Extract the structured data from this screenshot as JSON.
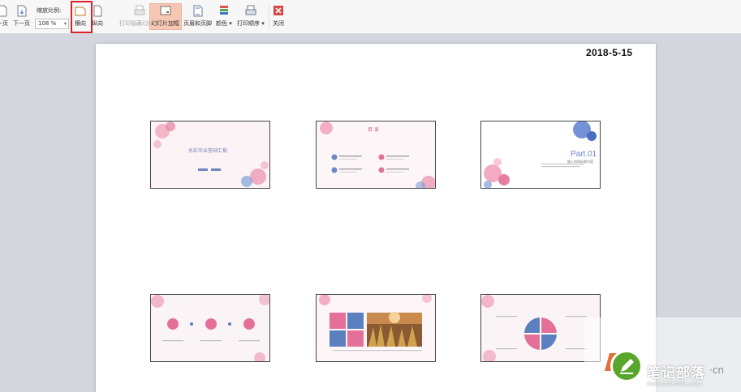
{
  "toolbar": {
    "prev_label": "一页",
    "next_label": "下一页",
    "zoom_title": "缩放比例:",
    "zoom_value": "108 %",
    "landscape_label": "横向",
    "portrait_label": "纵向",
    "print_hidden_label": "打印隐藏幻灯片",
    "slide_frame_label": "幻灯片加框",
    "header_footer_label": "页眉和页脚",
    "color_label": "颜色",
    "print_order_label": "打印顺序",
    "close_label": "关闭"
  },
  "page": {
    "date": "2018-5-15"
  },
  "slides": {
    "s1_title": "水彩毕业答辩汇报",
    "s2_title": "目 录",
    "s3_part": "Part.01",
    "s3_subtitle": "输入你的标题内容"
  },
  "watermark": {
    "brand": "笔记部落",
    "url": "www.notetribe.com",
    "suffix": "·cn"
  },
  "colors": {
    "highlight": "#d8232a",
    "pink": "#e4709a",
    "blue": "#5c7fc0",
    "active": "#f6c7b3"
  }
}
